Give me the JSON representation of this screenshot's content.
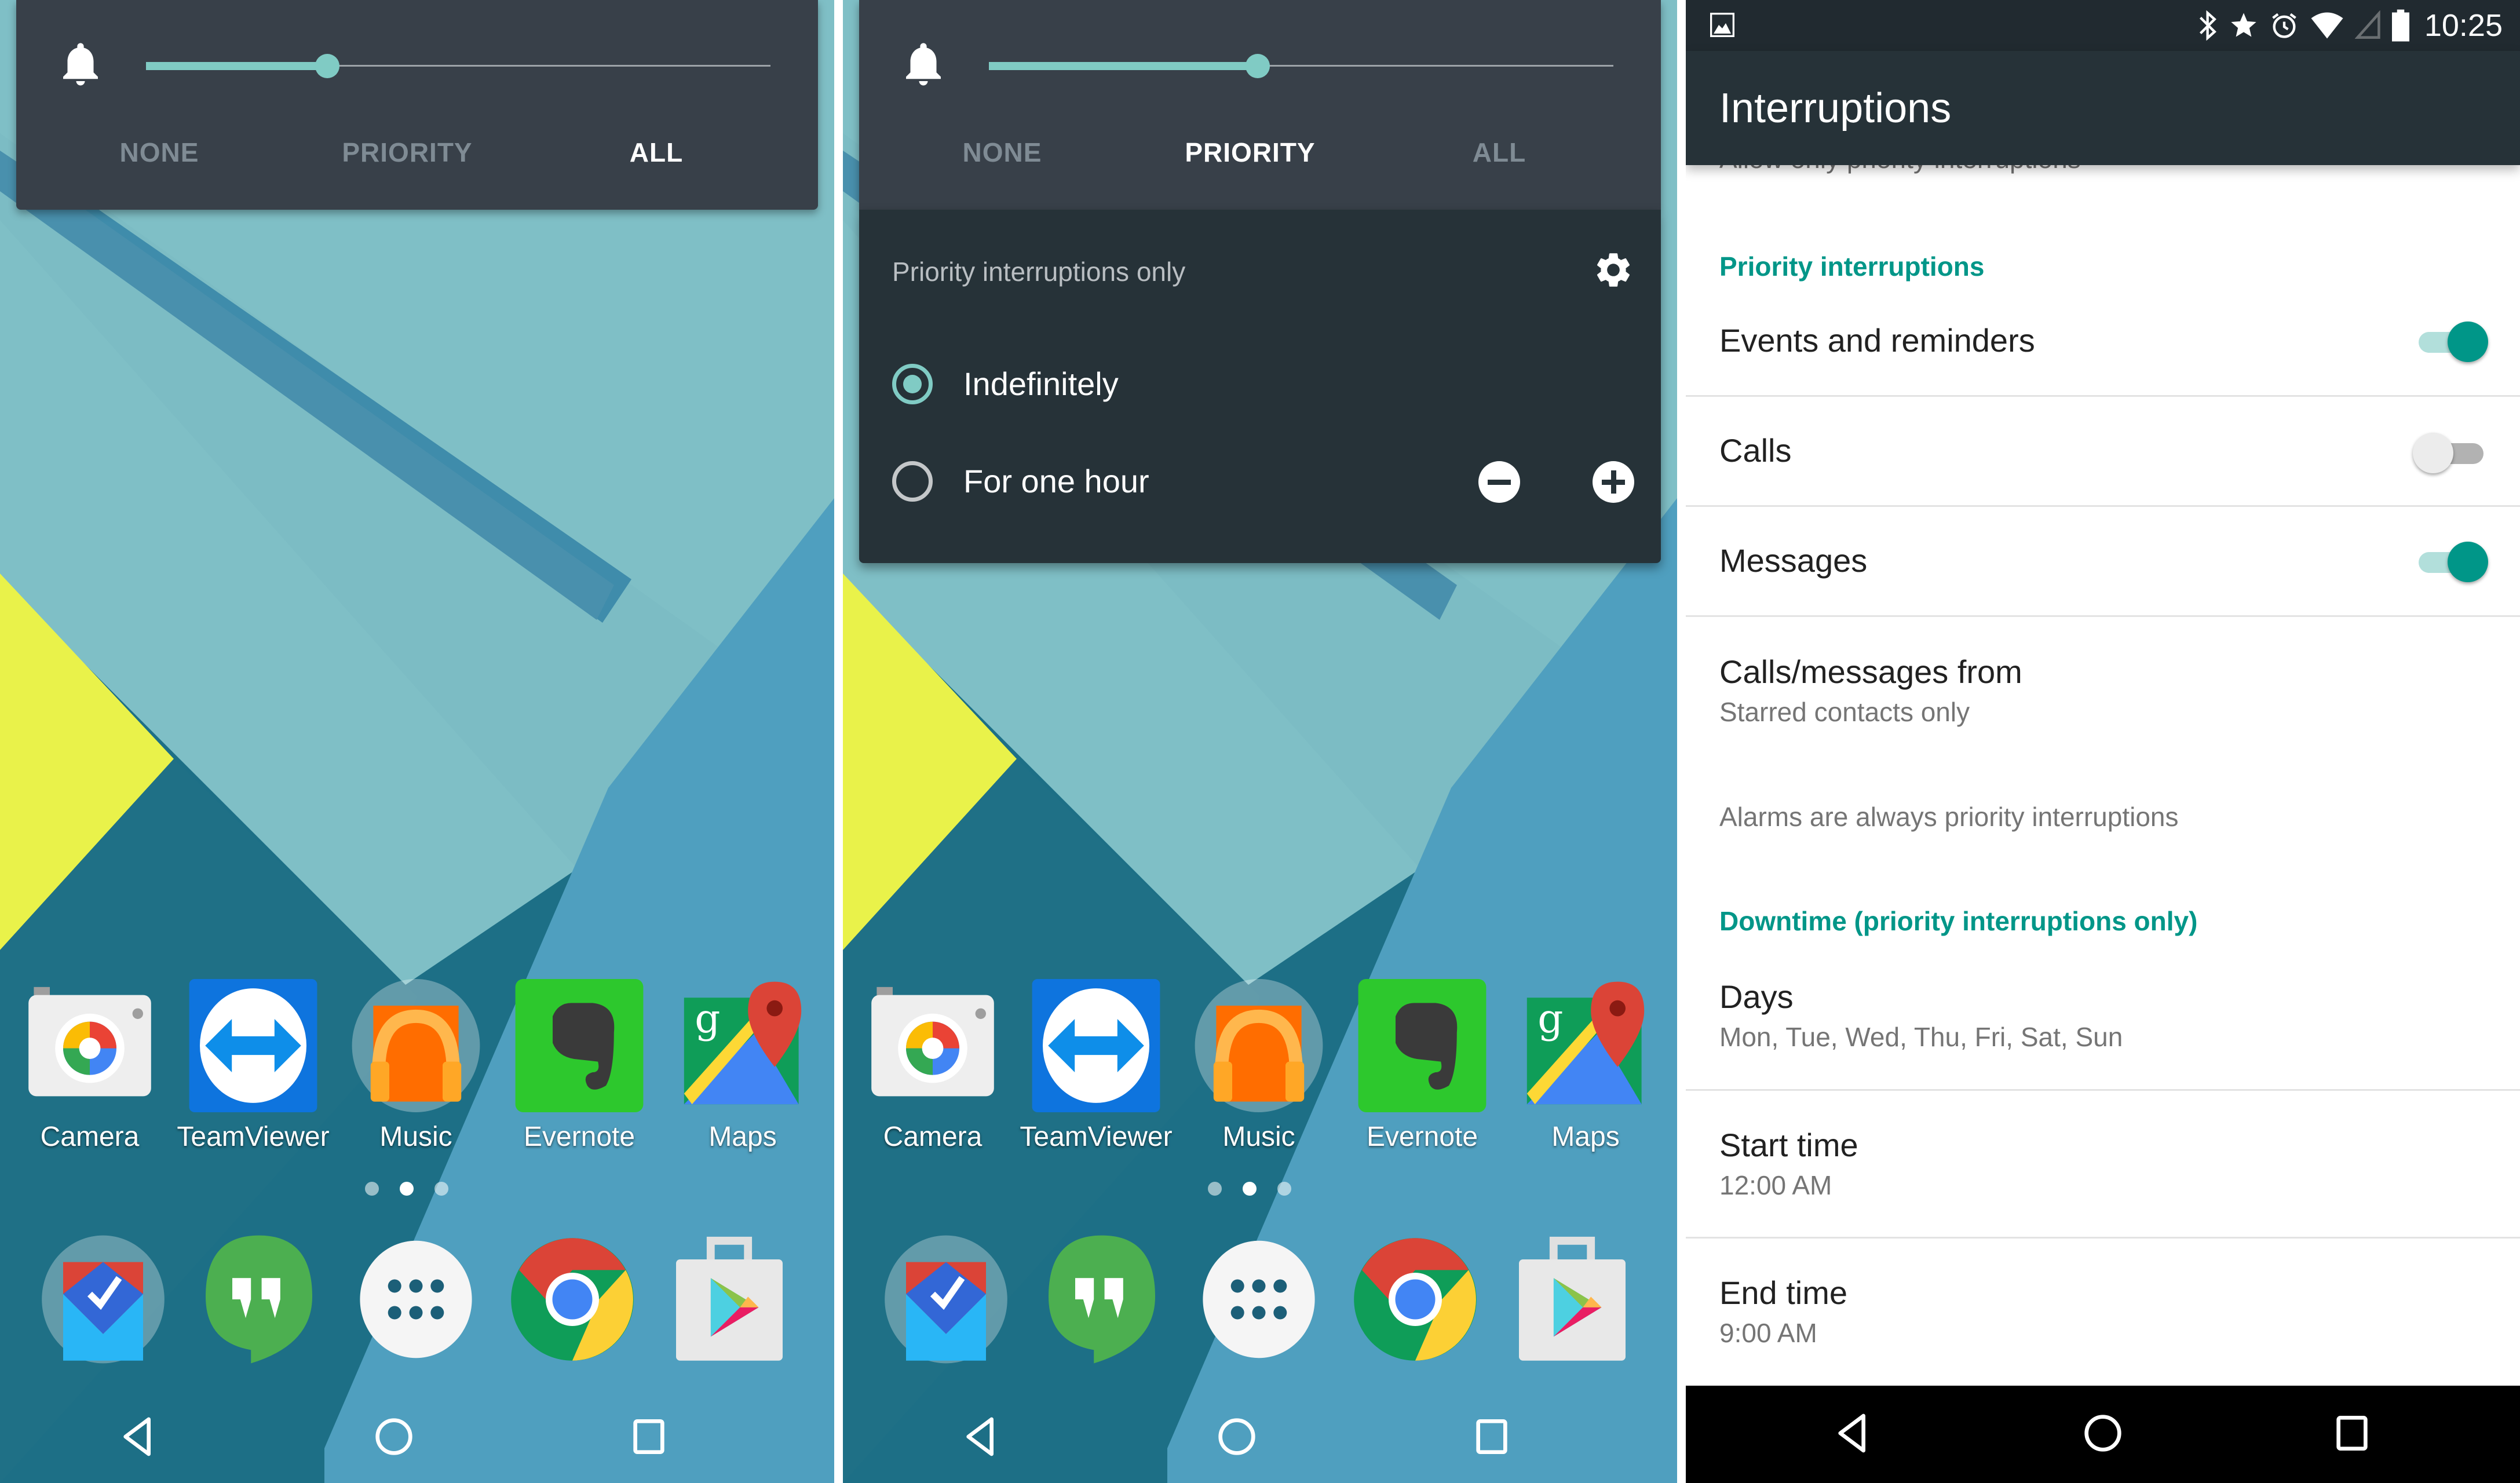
{
  "screens": {
    "home_all": {
      "interruption_modes": [
        "NONE",
        "PRIORITY",
        "ALL"
      ],
      "selected_mode": "ALL",
      "volume_level": 0.29
    },
    "home_priority": {
      "interruption_modes": [
        "NONE",
        "PRIORITY",
        "ALL"
      ],
      "selected_mode": "PRIORITY",
      "volume_level": 0.43,
      "priority_panel": {
        "title": "Priority interruptions only",
        "settings_icon": "gear-icon",
        "options": [
          {
            "label": "Indefinitely",
            "checked": true
          },
          {
            "label": "For one hour",
            "checked": false
          }
        ],
        "decrease_icon": "minus-circle-icon",
        "increase_icon": "plus-circle-icon"
      }
    },
    "settings": {
      "status_bar": {
        "left_icon": "image-notification-icon",
        "icons": [
          "bluetooth-icon",
          "star-icon",
          "alarm-icon",
          "wifi-icon",
          "cell-signal-icon",
          "battery-icon"
        ],
        "time": "10:25"
      },
      "title": "Interruptions",
      "hidden_subtitle": "Allow only priority interruptions",
      "sections": {
        "priority_header": "Priority interruptions",
        "events": {
          "label": "Events and reminders",
          "on": true
        },
        "calls": {
          "label": "Calls",
          "on": false
        },
        "messages": {
          "label": "Messages",
          "on": true
        },
        "from": {
          "label": "Calls/messages from",
          "value": "Starred contacts only"
        },
        "alarms_note": "Alarms are always priority interruptions",
        "downtime_header": "Downtime (priority interruptions only)",
        "days": {
          "label": "Days",
          "value": "Mon, Tue, Wed, Thu, Fri, Sat, Sun"
        },
        "start": {
          "label": "Start time",
          "value": "12:00 AM"
        },
        "end": {
          "label": "End time",
          "value": "9:00 AM"
        }
      }
    }
  },
  "home": {
    "apps": [
      {
        "label": "Camera",
        "icon": "camera-app-icon"
      },
      {
        "label": "TeamViewer",
        "icon": "teamviewer-app-icon"
      },
      {
        "label": "Music",
        "icon": "music-app-icon"
      },
      {
        "label": "Evernote",
        "icon": "evernote-app-icon"
      },
      {
        "label": "Maps",
        "icon": "maps-app-icon"
      }
    ],
    "page_indicator": {
      "pages": 3,
      "current": 2
    },
    "dock": [
      "inbox-app-icon",
      "hangouts-app-icon",
      "app-drawer-icon",
      "chrome-app-icon",
      "play-store-app-icon"
    ]
  },
  "nav": [
    "back-icon",
    "home-icon",
    "recents-icon"
  ],
  "colors": {
    "accent_teal": "#009688",
    "slider_teal": "#80cbc4",
    "popup_top": "#384049",
    "popup_bottom": "#263238",
    "appbar": "#263238",
    "statusbar": "#212a30"
  }
}
